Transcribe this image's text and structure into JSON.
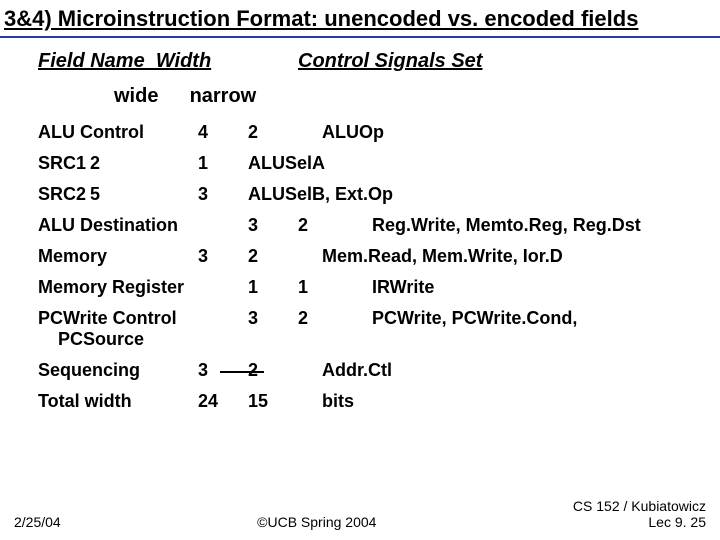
{
  "title": "3&4) Microinstruction Format: unencoded vs. encoded fields",
  "header": {
    "c1": "Field Name  Width",
    "c2": "Control Signals Set"
  },
  "sub": {
    "wide": "wide",
    "narrow": "narrow"
  },
  "rows": {
    "r0": {
      "name": "ALU Control",
      "w1": "4",
      "w2": "2",
      "sig": "ALUOp"
    },
    "r1": {
      "name": "SRC1",
      "w1": "2",
      "w2": "1",
      "sig": "ALUSelA"
    },
    "r2": {
      "name": "SRC2",
      "w1": "5",
      "w2": "3",
      "sig": "ALUSelB, Ext.Op"
    },
    "r3": {
      "name": "ALU Destination",
      "w1": "3",
      "w2": "2",
      "sig": "Reg.Write, Memto.Reg, Reg.Dst"
    },
    "r4": {
      "name": "Memory",
      "w1": "3",
      "w2": "2",
      "sig": "Mem.Read, Mem.Write, Ior.D"
    },
    "r5": {
      "name": "Memory Register",
      "w1": "1",
      "w2": "1",
      "sig": "IRWrite"
    },
    "r6": {
      "name": "PCWrite Control",
      "name2": "PCSource",
      "w1": "3",
      "w2": "2",
      "sig": "PCWrite, PCWrite.Cond,"
    },
    "r7": {
      "name": "Sequencing",
      "w1": "3",
      "w2": "2",
      "sig": "Addr.Ctl"
    },
    "r8": {
      "name": "Total width",
      "w1": "24",
      "w2": "15",
      "sig": "bits"
    }
  },
  "footer": {
    "left": "2/25/04",
    "mid": "©UCB Spring 2004",
    "right1": "CS 152 / Kubiatowicz",
    "right2": "Lec 9. 25"
  }
}
